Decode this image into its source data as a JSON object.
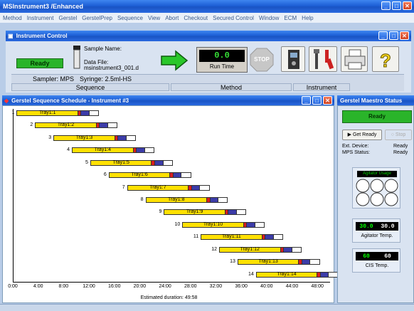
{
  "app": {
    "title": "MSInstrument3 /Enhanced"
  },
  "menu": [
    "Method",
    "Instrument",
    "Gerstel",
    "GerstelPrep",
    "Sequence",
    "View",
    "Abort",
    "Checkout",
    "Secured Control",
    "Window",
    "ECM",
    "Help"
  ],
  "instrument_control": {
    "title": "Instrument Control",
    "status": "Ready",
    "sample_name_label": "Sample Name:",
    "data_file_label": "Data File:",
    "data_file_value": "msinstrument3_001.d",
    "run_time_value": "0.0",
    "run_time_label": "Run Time",
    "stop_label": "STOP",
    "sampler": "Sampler: MPS",
    "syringe": "Syringe: 2.5ml-HS",
    "sections": [
      "Sequence",
      "Method",
      "Instrument"
    ]
  },
  "schedule": {
    "title": "Gerstel Sequence Schedule - Instrument #3",
    "estimated_duration": "Estimated duration: 49:58"
  },
  "chart_data": {
    "type": "gantt",
    "x_unit": "time (mm:ss)",
    "xlim": [
      0,
      50
    ],
    "x_ticks": [
      "0:00",
      "4:00",
      "8:00",
      "12:00",
      "16:00",
      "20:00",
      "24:00",
      "28:00",
      "32:00",
      "36:00",
      "40:00",
      "44:00",
      "48:00"
    ],
    "rows": [
      {
        "index": "1",
        "label": "Tray1:1",
        "start": 0.5
      },
      {
        "index": "2",
        "label": "Tray1:2",
        "start": 3.4
      },
      {
        "index": "3",
        "label": "Tray1:3",
        "start": 6.3
      },
      {
        "index": "4",
        "label": "Tray1:4",
        "start": 9.2
      },
      {
        "index": "5",
        "label": "Tray1:5",
        "start": 12.1
      },
      {
        "index": "6",
        "label": "Tray1:6",
        "start": 15.0
      },
      {
        "index": "7",
        "label": "Tray1:7",
        "start": 17.9
      },
      {
        "index": "8",
        "label": "Tray1:8",
        "start": 20.8
      },
      {
        "index": "9",
        "label": "Tray1:9",
        "start": 23.7
      },
      {
        "index": "10",
        "label": "Tray1:10",
        "start": 26.6
      },
      {
        "index": "11",
        "label": "Tray1:11",
        "start": 29.5
      },
      {
        "index": "12",
        "label": "Tray1:12",
        "start": 32.4
      },
      {
        "index": "13",
        "label": "Tray1:13",
        "start": 35.3
      },
      {
        "index": "14",
        "label": "Tray1:14",
        "start": 38.2
      }
    ],
    "segments_minutes": {
      "yellow": 9.7,
      "red": 0.5,
      "blue": 1.3,
      "white": 1.5
    },
    "colors": {
      "yellow": "#ffe100",
      "red": "#d81e1e",
      "blue": "#3c3ca8",
      "white": "#ffffff"
    }
  },
  "maestro": {
    "title": "Gerstel Maestro Status",
    "status": "Ready",
    "get_ready_label": "Get Ready",
    "stop_label": "Stop",
    "ext_device_label": "Ext. Device:",
    "ext_device_value": "Ready",
    "mps_status_label": "MPS Status:",
    "mps_status_value": "Ready",
    "agitator_usage_label": "Agitator Usage",
    "agitator_actual": "30.0",
    "agitator_setpoint": "30.0",
    "agitator_label": "Agitator Temp.",
    "cis_actual": "60",
    "cis_setpoint": "60",
    "cis_label": "CIS Temp."
  }
}
